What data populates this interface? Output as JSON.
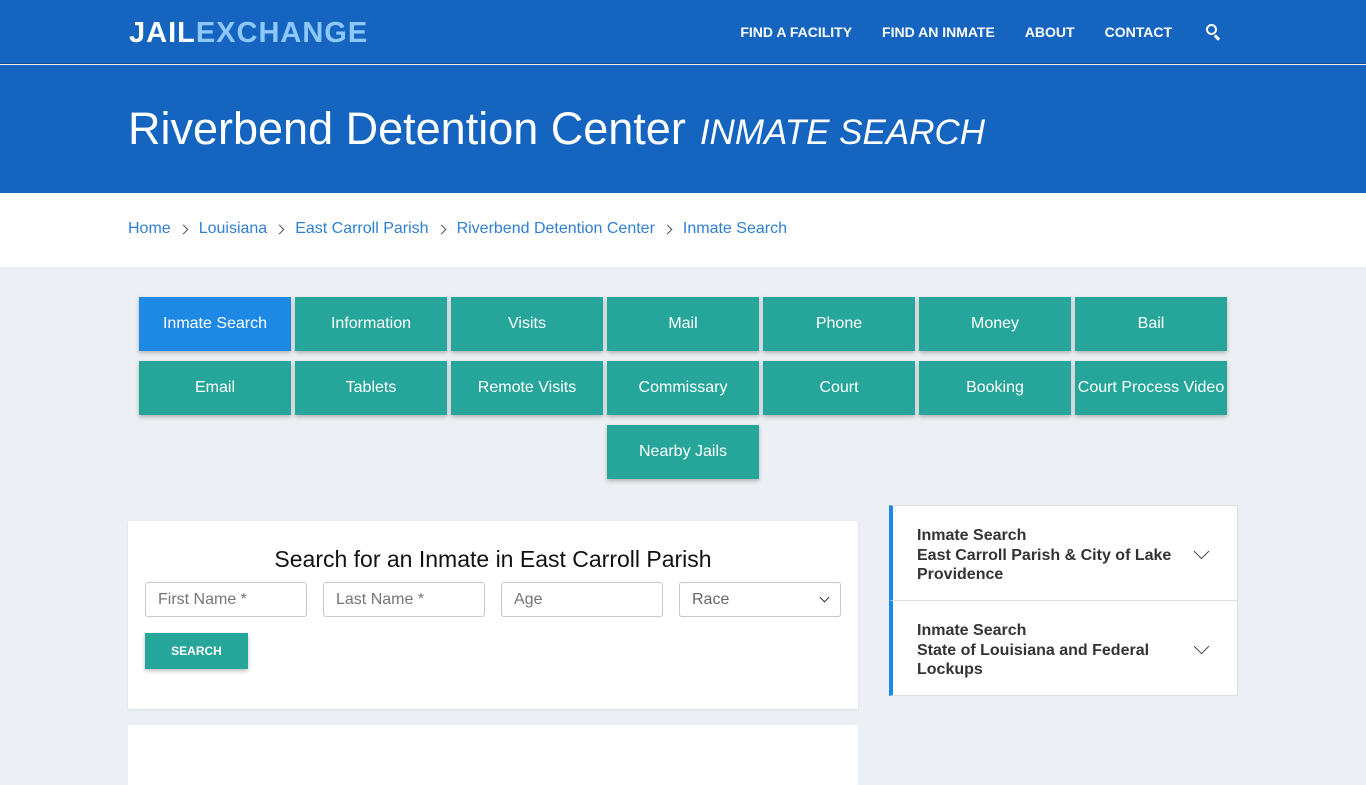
{
  "logo": {
    "part1": "JAIL",
    "part2": "EXCHANGE"
  },
  "nav": [
    "FIND A FACILITY",
    "FIND AN INMATE",
    "ABOUT",
    "CONTACT"
  ],
  "hero": {
    "title": "Riverbend Detention Center",
    "subtitle": "INMATE SEARCH"
  },
  "breadcrumb": [
    "Home",
    "Louisiana",
    "East Carroll Parish",
    "Riverbend Detention Center",
    "Inmate Search"
  ],
  "tiles": [
    "Inmate Search",
    "Information",
    "Visits",
    "Mail",
    "Phone",
    "Money",
    "Bail",
    "Email",
    "Tablets",
    "Remote Visits",
    "Commissary",
    "Court",
    "Booking",
    "Court Process Video",
    "Nearby Jails"
  ],
  "search": {
    "title": "Search for an Inmate in East Carroll Parish",
    "first_placeholder": "First Name *",
    "last_placeholder": "Last Name *",
    "age_placeholder": "Age",
    "race_selected": "Race",
    "button": "SEARCH"
  },
  "sidebar": [
    {
      "line1": "Inmate Search",
      "line2": "East Carroll Parish & City of Lake Providence"
    },
    {
      "line1": "Inmate Search",
      "line2": "State of Louisiana and Federal Lockups"
    }
  ],
  "colors": {
    "brand": "#1565c0",
    "tile": "#26a69a",
    "active": "#1e88e5"
  }
}
